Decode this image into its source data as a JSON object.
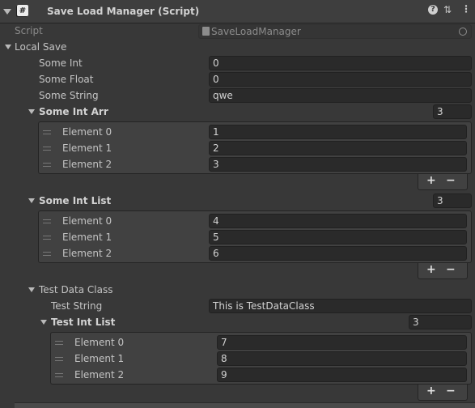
{
  "header": {
    "title": "Save Load Manager (Script)",
    "icons": [
      "help-icon",
      "preset-icon",
      "more-menu-icon"
    ]
  },
  "script_row": {
    "label": "Script",
    "value": "SaveLoadManager"
  },
  "local_save": {
    "label": "Local Save",
    "some_int": {
      "label": "Some Int",
      "value": "0"
    },
    "some_float": {
      "label": "Some Float",
      "value": "0"
    },
    "some_string": {
      "label": "Some String",
      "value": "qwe"
    },
    "some_int_arr": {
      "label": "Some Int Arr",
      "size": "3",
      "elements": [
        {
          "label": "Element 0",
          "value": "1"
        },
        {
          "label": "Element 1",
          "value": "2"
        },
        {
          "label": "Element 2",
          "value": "3"
        }
      ]
    },
    "some_int_list": {
      "label": "Some Int List",
      "size": "3",
      "elements": [
        {
          "label": "Element 0",
          "value": "4"
        },
        {
          "label": "Element 1",
          "value": "5"
        },
        {
          "label": "Element 2",
          "value": "6"
        }
      ]
    },
    "test_data_class": {
      "label": "Test Data Class",
      "test_string": {
        "label": "Test String",
        "value": "This is TestDataClass"
      },
      "test_int_list": {
        "label": "Test Int List",
        "size": "3",
        "elements": [
          {
            "label": "Element 0",
            "value": "7"
          },
          {
            "label": "Element 1",
            "value": "8"
          },
          {
            "label": "Element 2",
            "value": "9"
          }
        ]
      }
    }
  },
  "list_controls": {
    "add": "+",
    "remove": "−"
  },
  "colors": {
    "background": "#383838",
    "header": "#3e3e3e",
    "field": "#2a2a2a",
    "list_box": "#414141"
  }
}
